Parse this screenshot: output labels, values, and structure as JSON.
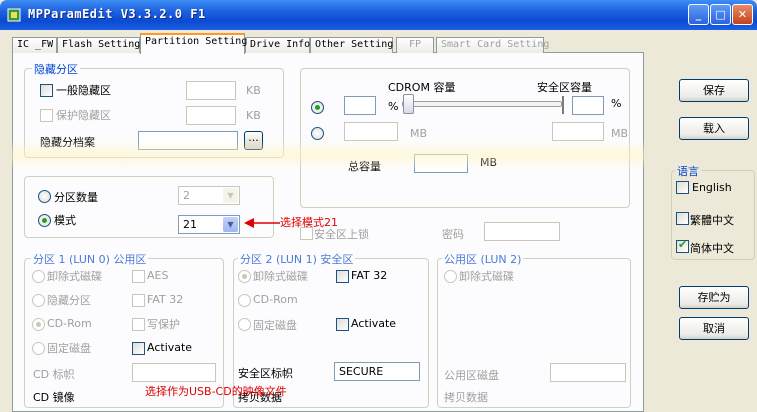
{
  "window": {
    "title": "MPParamEdit V3.3.2.0 F1",
    "minimize": "_",
    "maximize": "□",
    "close": "✕"
  },
  "tabs": [
    {
      "label": "IC _FW"
    },
    {
      "label": "Flash Setting"
    },
    {
      "label": "Partition Setting"
    },
    {
      "label": "Drive Info"
    },
    {
      "label": "Other Setting"
    },
    {
      "label": "FP"
    },
    {
      "label": "Smart Card Setting"
    }
  ],
  "hidden_group": {
    "legend": "隐藏分区",
    "general": "一般隐藏区",
    "protect": "保护隐藏区",
    "unit": "KB",
    "file_label": "隐藏分档案",
    "browse": "..."
  },
  "cdrom": {
    "cdrom_cap": "CDROM 容量",
    "secure_cap": "安全区容量",
    "percent": "%",
    "mb": "MB",
    "total_label": "总容量",
    "slider_value": 0
  },
  "partition": {
    "count_label": "分区数量",
    "count_value": "2",
    "mode_label": "模式",
    "mode_value": "21",
    "annotation": "选择模式21",
    "secure_lock": "安全区上锁",
    "password": "密码"
  },
  "part1": {
    "legend": "分区 1 (LUN 0) 公用区",
    "removable": "卸除式磁碟",
    "aes": "AES",
    "hidden": "隐藏分区",
    "fat32": "FAT 32",
    "cdrom": "CD-Rom",
    "wp": "写保护",
    "fixed": "固定磁盘",
    "activate": "Activate",
    "cd_label": "CD 标帜",
    "cd_image": "CD 镜像",
    "annotation": "选择作为USB-CD的映像文件"
  },
  "part2": {
    "legend": "分区 2 (LUN 1) 安全区",
    "removable": "卸除式磁碟",
    "fat32": "FAT 32",
    "cdrom": "CD-Rom",
    "fixed": "固定磁盘",
    "activate": "Activate",
    "secure_label": "安全区标帜",
    "secure_value": "SECURE",
    "copy": "拷贝数据"
  },
  "public": {
    "legend": "公用区 (LUN 2)",
    "removable": "卸除式磁碟",
    "disk": "公用区磁盘",
    "copy": "拷贝数据"
  },
  "side": {
    "save": "保存",
    "load": "载入",
    "lang_legend": "语言",
    "english": "English",
    "trad": "繁體中文",
    "simp": "简体中文",
    "save_as": "存贮为",
    "cancel": "取消"
  }
}
